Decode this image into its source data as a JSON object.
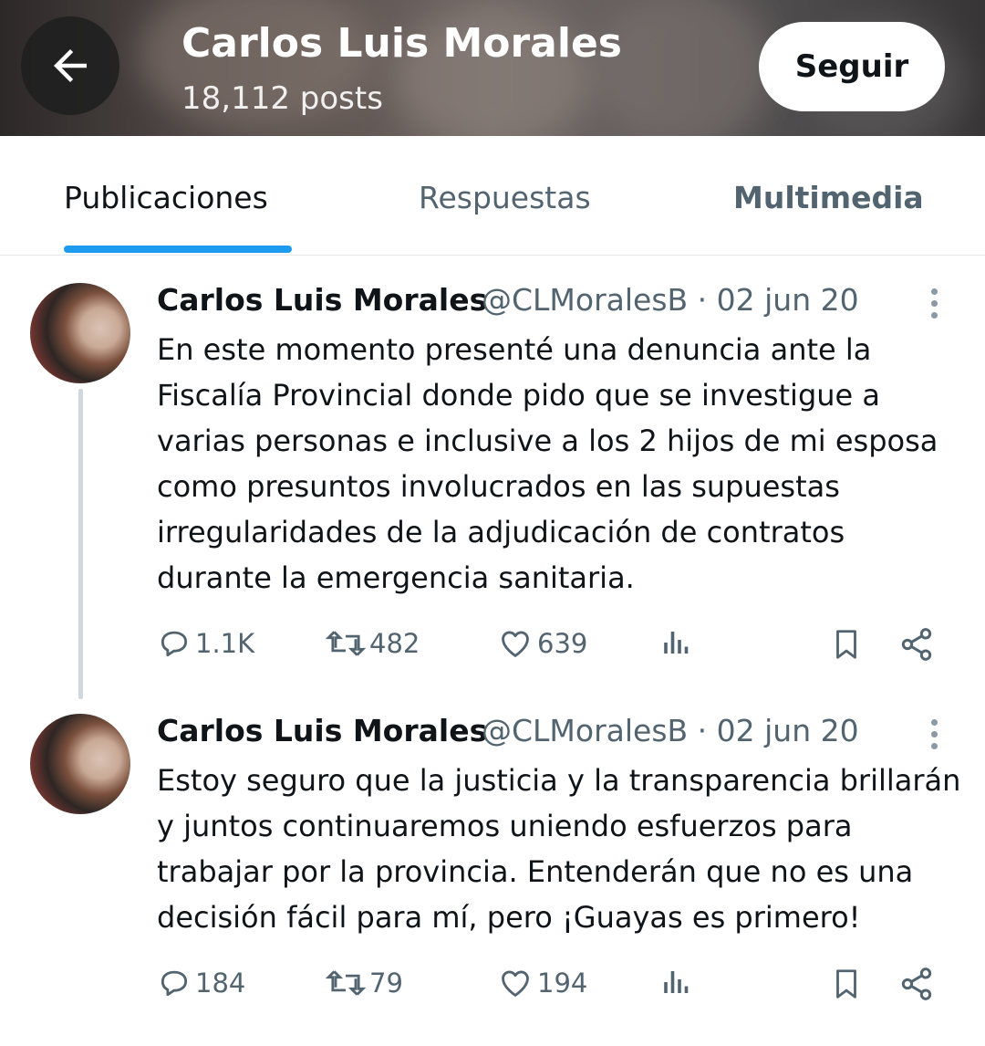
{
  "header": {
    "back_icon": "arrow-left-icon",
    "name": "Carlos Luis Morales",
    "posts": "18,112 posts",
    "follow_label": "Seguir"
  },
  "tabs": [
    {
      "label": "Publicaciones",
      "active": true
    },
    {
      "label": "Respuestas",
      "active": false
    },
    {
      "label": "Multimedia",
      "active": false
    }
  ],
  "colors": {
    "accent": "#1d9bf0",
    "muted": "#536471",
    "text": "#0f1419"
  },
  "tweets": [
    {
      "name": "Carlos Luis Morales",
      "handle_date": "@CLMoralesB · 02 jun 20",
      "text": "En este momento presenté una denuncia ante la Fiscalía Provincial donde pido que se investigue a varias personas e inclusive a los 2 hijos de mi esposa como presuntos involucrados en las supuestas irregularidades de la adjudicación de contratos durante la emergencia sanitaria.",
      "replies": "1.1K",
      "retweets": "482",
      "likes": "639"
    },
    {
      "name": "Carlos Luis Morales",
      "handle_date": "@CLMoralesB · 02 jun 20",
      "text": "Estoy seguro que la justicia y la transparencia brillarán y juntos continuaremos uniendo esfuerzos para trabajar por la provincia. Entenderán que no es una decisión fácil para mí, pero ¡Guayas es primero!",
      "replies": "184",
      "retweets": "79",
      "likes": "194"
    }
  ]
}
